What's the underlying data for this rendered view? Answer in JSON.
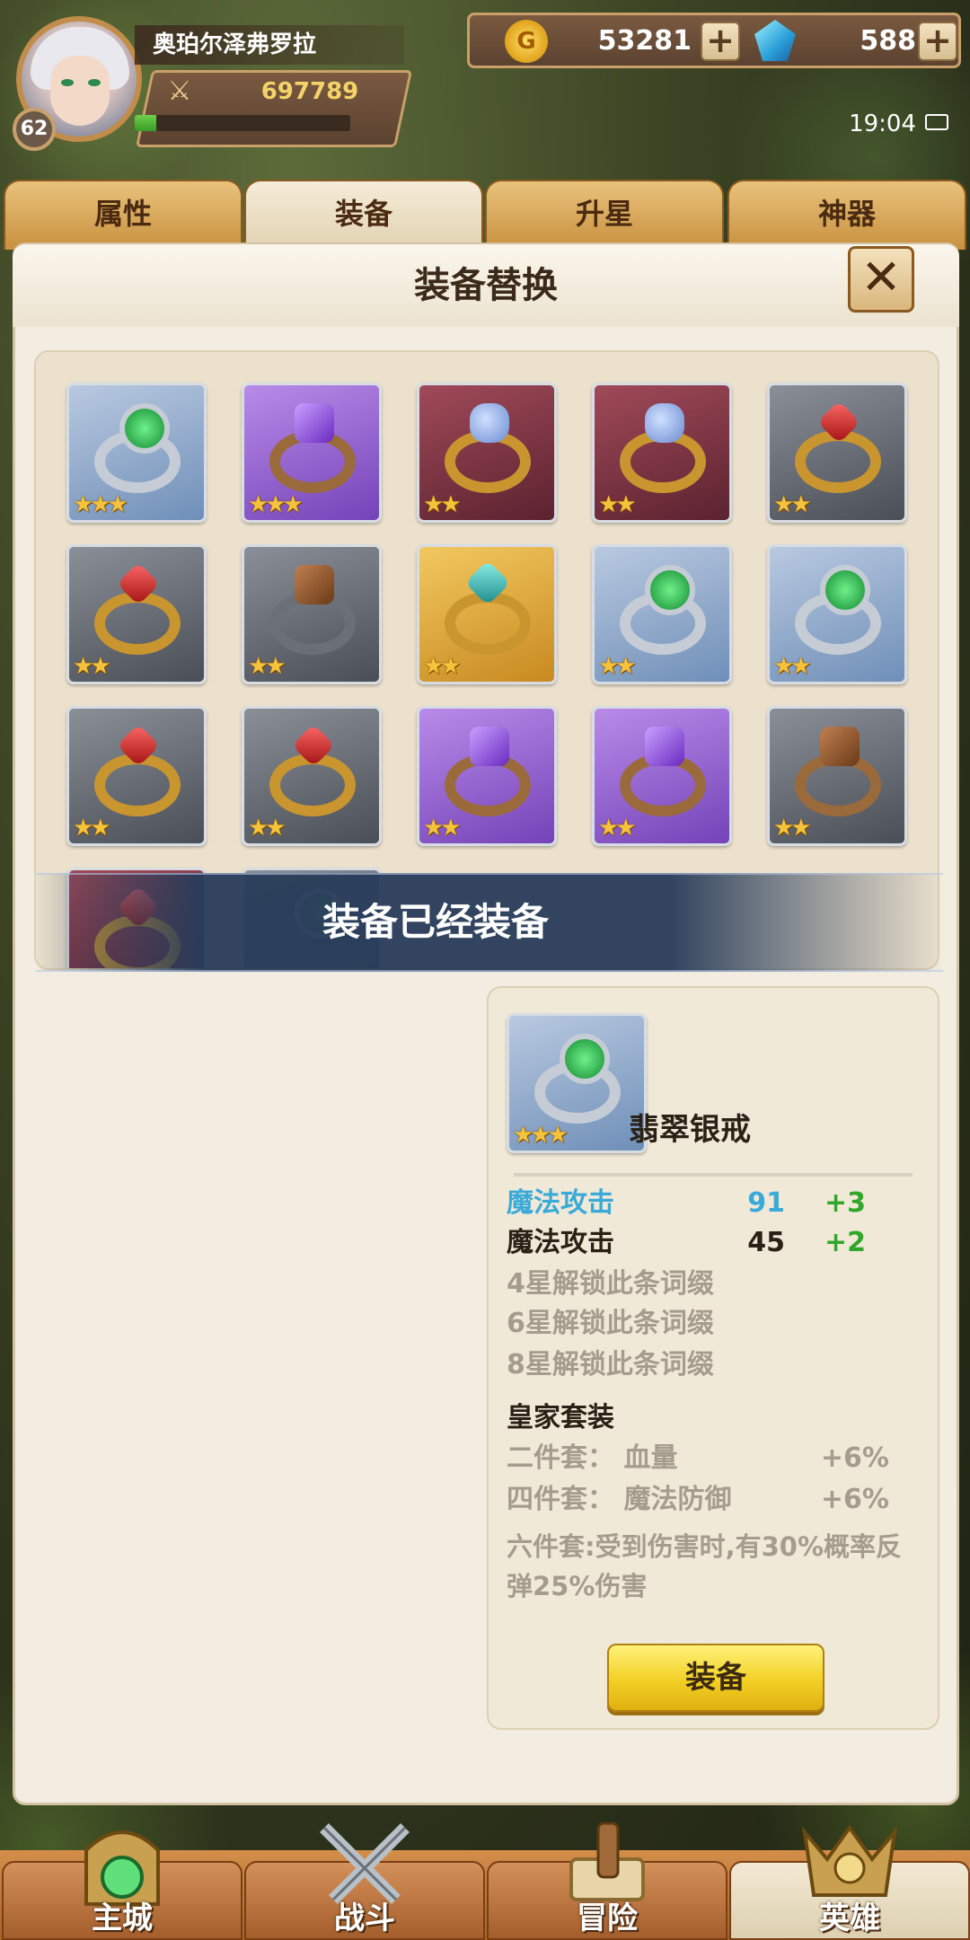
{
  "player": {
    "name": "奥珀尔泽弗罗拉",
    "level": "62",
    "power": "697789",
    "exp_fraction": 0.1
  },
  "currency": {
    "gold": "53281",
    "gems": "588",
    "gold_glyph": "G"
  },
  "status": {
    "time": "19:04"
  },
  "tabs": [
    {
      "label": "属性",
      "active": false
    },
    {
      "label": "装备",
      "active": true
    },
    {
      "label": "升星",
      "active": false
    },
    {
      "label": "神器",
      "active": false
    }
  ],
  "dialog": {
    "title": "装备替换",
    "close_glyph": "✕"
  },
  "items": [
    {
      "quality": "blue",
      "gem": "green",
      "ring": "silver",
      "stars": "★★★"
    },
    {
      "quality": "purple",
      "gem": "purple",
      "ring": "bronze",
      "stars": "★★★"
    },
    {
      "quality": "red",
      "gem": "blue",
      "ring": "gold",
      "stars": "★★"
    },
    {
      "quality": "red",
      "gem": "blue",
      "ring": "gold",
      "stars": "★★"
    },
    {
      "quality": "gray",
      "gem": "red",
      "ring": "gold",
      "stars": "★★"
    },
    {
      "quality": "gray",
      "gem": "red",
      "ring": "gold",
      "stars": "★★"
    },
    {
      "quality": "gray",
      "gem": "copper",
      "ring": "dark",
      "stars": "★★"
    },
    {
      "quality": "gold",
      "gem": "teal",
      "ring": "gold",
      "stars": "★★"
    },
    {
      "quality": "blue",
      "gem": "green",
      "ring": "silver",
      "stars": "★★"
    },
    {
      "quality": "blue",
      "gem": "green",
      "ring": "silver",
      "stars": "★★"
    },
    {
      "quality": "gray",
      "gem": "red",
      "ring": "gold",
      "stars": "★★"
    },
    {
      "quality": "gray",
      "gem": "red",
      "ring": "gold",
      "stars": "★★"
    },
    {
      "quality": "purple",
      "gem": "purple",
      "ring": "bronze",
      "stars": "★★"
    },
    {
      "quality": "purple",
      "gem": "purple",
      "ring": "bronze",
      "stars": "★★"
    },
    {
      "quality": "gray",
      "gem": "copper",
      "ring": "bronze",
      "stars": "★★"
    },
    {
      "quality": "red",
      "gem": "red",
      "ring": "gold",
      "stars": ""
    },
    {
      "quality": "gray",
      "gem": "green",
      "ring": "dark",
      "stars": ""
    }
  ],
  "toast": "装备已经装备",
  "detail": {
    "name": "翡翠银戒",
    "stars": "★★★",
    "stats": [
      {
        "name": "魔法攻击",
        "value": "91",
        "bonus": "+3",
        "color": "#3aaad8"
      },
      {
        "name": "魔法攻击",
        "value": "45",
        "bonus": "+2",
        "color": "#2b2015"
      }
    ],
    "locked": [
      "4星解锁此条词缀",
      "6星解锁此条词缀",
      "8星解锁此条词缀"
    ],
    "set_title": "皇家套装",
    "set_bonuses": [
      {
        "label": "二件套：  血量",
        "value": "+6%"
      },
      {
        "label": "四件套：  魔法防御",
        "value": "+6%"
      }
    ],
    "set_six": "六件套:受到伤害时,有30%概率反弹25%伤害",
    "equip_label": "装备"
  },
  "nav": [
    {
      "label": "主城",
      "active": false
    },
    {
      "label": "战斗",
      "active": false
    },
    {
      "label": "冒险",
      "active": false
    },
    {
      "label": "英雄",
      "active": true
    }
  ],
  "colors": {
    "accent_gold": "#f2cf25",
    "bonus_green": "#2fa82a",
    "magic_blue": "#3aaad8"
  }
}
